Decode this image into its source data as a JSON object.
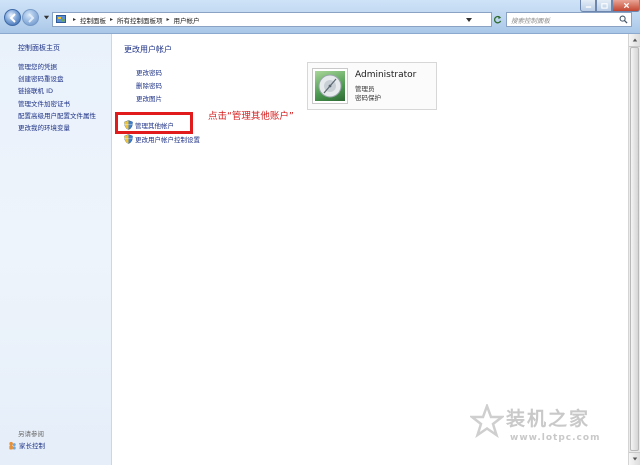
{
  "window": {
    "breadcrumb": [
      "控制面板",
      "所有控制面板项",
      "用户帐户"
    ],
    "search_placeholder": "搜索控制面板",
    "icons": {
      "back": "back-arrow-icon",
      "forward": "forward-arrow-icon",
      "refresh": "refresh-icon",
      "search": "search-icon"
    }
  },
  "sidebar": {
    "home": "控制面板主页",
    "items": [
      "管理您的凭据",
      "创建密码重设盘",
      "链接联机 ID",
      "管理文件加密证书",
      "配置高级用户配置文件属性",
      "更改我的环境变量"
    ],
    "see_also": "另请参阅",
    "family_safety": "家长控制"
  },
  "main": {
    "title": "更改用户帐户",
    "tasks": [
      "更改密码",
      "删除密码",
      "更改图片"
    ],
    "manage_other": "管理其他帐户",
    "uac_settings": "更改用户帐户控制设置",
    "annotation": "点击“管理其他账户”"
  },
  "account": {
    "name": "Administrator",
    "role": "管理员",
    "status": "密码保护"
  },
  "watermark": {
    "text": "装机之家",
    "url": "www.lotpc.com"
  },
  "colors": {
    "link": "#1e3287",
    "annotation": "#d42020",
    "highlight": "#e11b1b"
  }
}
